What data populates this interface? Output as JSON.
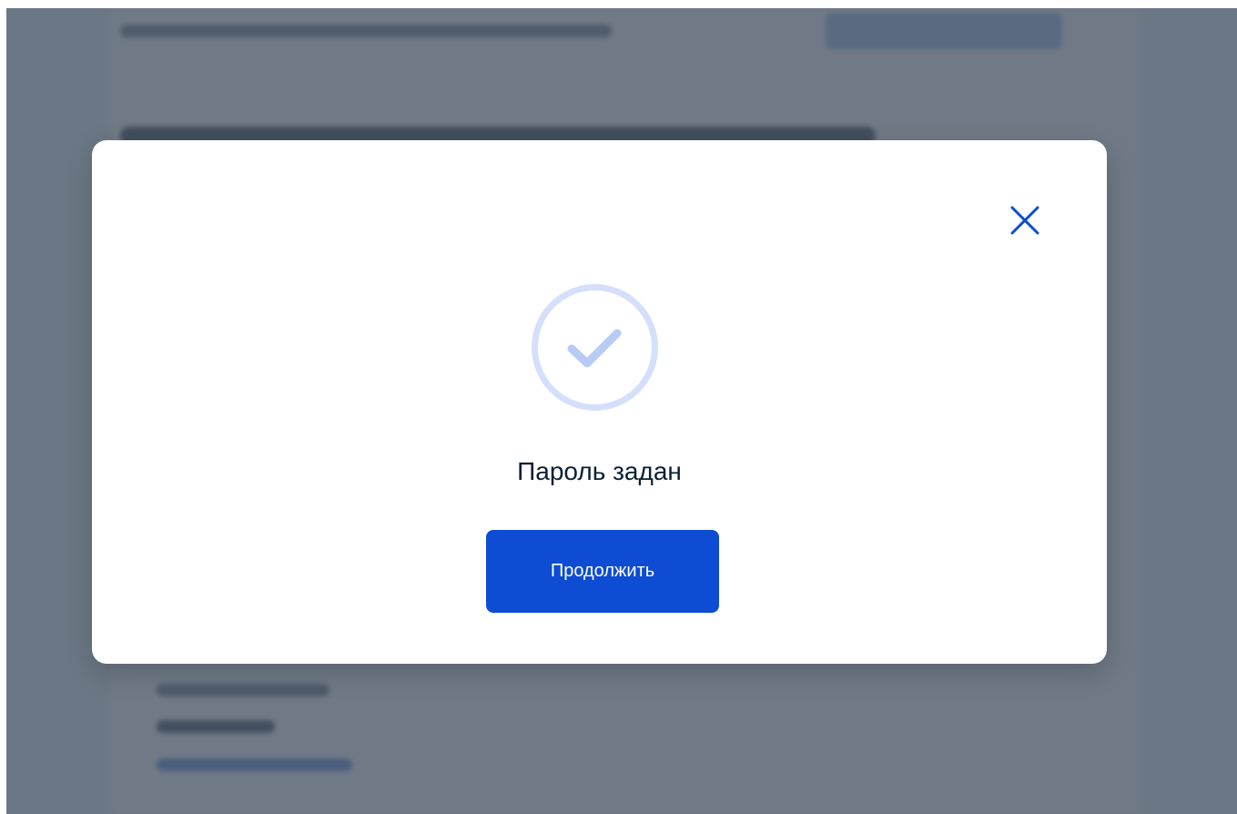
{
  "modal": {
    "title": "Пароль задан",
    "continue_label": "Продолжить",
    "close_icon": "close-icon",
    "status_icon": "check-circle-icon"
  },
  "colors": {
    "accent": "#0d4cd3",
    "icon_ring": "#d4e0fb",
    "icon_check": "#b7cbf5",
    "close_icon": "#0d4cd3",
    "overlay": "#46556480"
  }
}
